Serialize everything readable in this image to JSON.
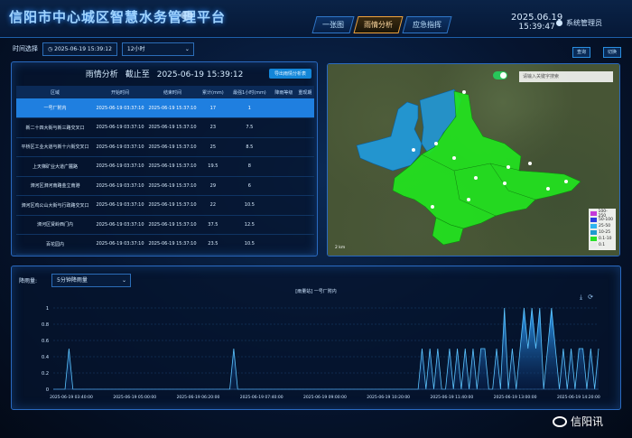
{
  "header": {
    "title": "信阳市中心城区智慧水务管理平台",
    "nav": [
      "一张图",
      "雨情分析",
      "应急指挥"
    ],
    "active_nav": 1,
    "date": "2025.06.19",
    "time": "15:39:47",
    "user": "系统管理员"
  },
  "filter": {
    "label": "时间选择",
    "datetime": "2025-06-19 15:39:12",
    "range": "12小时",
    "btn_left": "查询",
    "btn_right": "切换"
  },
  "table_panel": {
    "title_a": "雨情分析",
    "title_b": "截止至",
    "title_time": "2025-06-19 15:39:12",
    "export_label": "导出雨情分析表",
    "columns": [
      "区域",
      "开始时间",
      "结束时间",
      "累计(mm)",
      "最强1小时(mm)",
      "降雨等级",
      "重现期"
    ],
    "rows": [
      [
        "一号厂附内",
        "2025-06-19 03:37:10",
        "2025-06-19 15:37:10",
        "17",
        "1",
        "",
        ""
      ],
      [
        "新二十四大街与新三路交叉口",
        "2025-06-19 03:37:10",
        "2025-06-19 15:37:10",
        "23",
        "7.5",
        "",
        ""
      ],
      [
        "平桥区工业大道与新十六街交叉口",
        "2025-06-19 03:37:10",
        "2025-06-19 15:37:10",
        "25",
        "8.5",
        "",
        ""
      ],
      [
        "上天梯矿业大道广麓路",
        "2025-06-19 03:37:10",
        "2025-06-19 15:37:10",
        "19.5",
        "8",
        "",
        ""
      ],
      [
        "浉河区浉河南路金立南港",
        "2025-06-19 03:37:10",
        "2025-06-19 15:37:10",
        "29",
        "6",
        "",
        ""
      ],
      [
        "浉河区鸡公山大街与行政路交叉口",
        "2025-06-19 03:37:10",
        "2025-06-19 15:37:10",
        "22",
        "10.5",
        "",
        ""
      ],
      [
        "浉河区贤岭西门内",
        "2025-06-19 03:37:10",
        "2025-06-19 15:37:10",
        "37.5",
        "12.5",
        "",
        ""
      ],
      [
        "百花园内",
        "2025-06-19 03:37:10",
        "2025-06-19 15:37:10",
        "23.5",
        "10.5",
        "",
        ""
      ]
    ],
    "selected_row": 0
  },
  "map": {
    "search_placeholder": "请输入关键字搜索",
    "legend": [
      {
        "label": "100-250",
        "color": "#c43ad8"
      },
      {
        "label": "50-100",
        "color": "#2a3be0"
      },
      {
        "label": "25-50",
        "color": "#2fb4f0"
      },
      {
        "label": "10-25",
        "color": "#1f9bd0"
      },
      {
        "label": "0.1-10",
        "color": "#28e028"
      },
      {
        "label": "0.1",
        "color": "#e8e8e8"
      }
    ],
    "scale_label": "2 km",
    "colors": {
      "blue": "#1f9be0",
      "green": "#22e41e"
    }
  },
  "chart_panel": {
    "label": "降雨量:",
    "select_value": "5分钟降雨量",
    "chart_title": "[雨量站] 一号厂附内"
  },
  "chart_data": {
    "type": "area",
    "ylim": [
      0,
      1
    ],
    "yticks": [
      "0",
      "0.2",
      "0.4",
      "0.6",
      "0.8",
      "1"
    ],
    "xticks": [
      "2025-06-19 03:40:00",
      "2025-06-19 05:00:00",
      "2025-06-19 06:20:00",
      "2025-06-19 07:40:00",
      "2025-06-19 09:00:00",
      "2025-06-19 10:20:00",
      "2025-06-19 11:40:00",
      "2025-06-19 13:00:00",
      "2025-06-19 14:20:00"
    ],
    "x_first_label": "2025-06-19 03:40:00",
    "series": [
      {
        "values": [
          0,
          0,
          0,
          0,
          0.5,
          0,
          0,
          0,
          0,
          0,
          0,
          0,
          0,
          0,
          0,
          0,
          0,
          0,
          0,
          0,
          0,
          0,
          0,
          0,
          0,
          0,
          0,
          0,
          0,
          0,
          0,
          0,
          0,
          0,
          0,
          0,
          0,
          0,
          0,
          0,
          0,
          0,
          0,
          0,
          0,
          0,
          0.5,
          0,
          0,
          0,
          0,
          0,
          0,
          0,
          0,
          0,
          0,
          0,
          0,
          0,
          0,
          0,
          0,
          0,
          0,
          0,
          0,
          0,
          0,
          0,
          0,
          0,
          0,
          0,
          0,
          0,
          0,
          0,
          0,
          0,
          0,
          0,
          0,
          0,
          0,
          0,
          0,
          0,
          0,
          0,
          0,
          0,
          0,
          0,
          0.5,
          0,
          0.5,
          0,
          0.5,
          0,
          0,
          0.5,
          0,
          0.5,
          0,
          0.5,
          0,
          0.5,
          0,
          0.5,
          0.5,
          0,
          0,
          0.5,
          0,
          1,
          0,
          0.5,
          0,
          0.5,
          1,
          0.5,
          1,
          0.5,
          1,
          0,
          0.5,
          1,
          0.5,
          0,
          0.5,
          0,
          0.5,
          0,
          0.5,
          0.5,
          0,
          0.5,
          0,
          0.5
        ]
      }
    ]
  },
  "watermark": "信阳讯"
}
